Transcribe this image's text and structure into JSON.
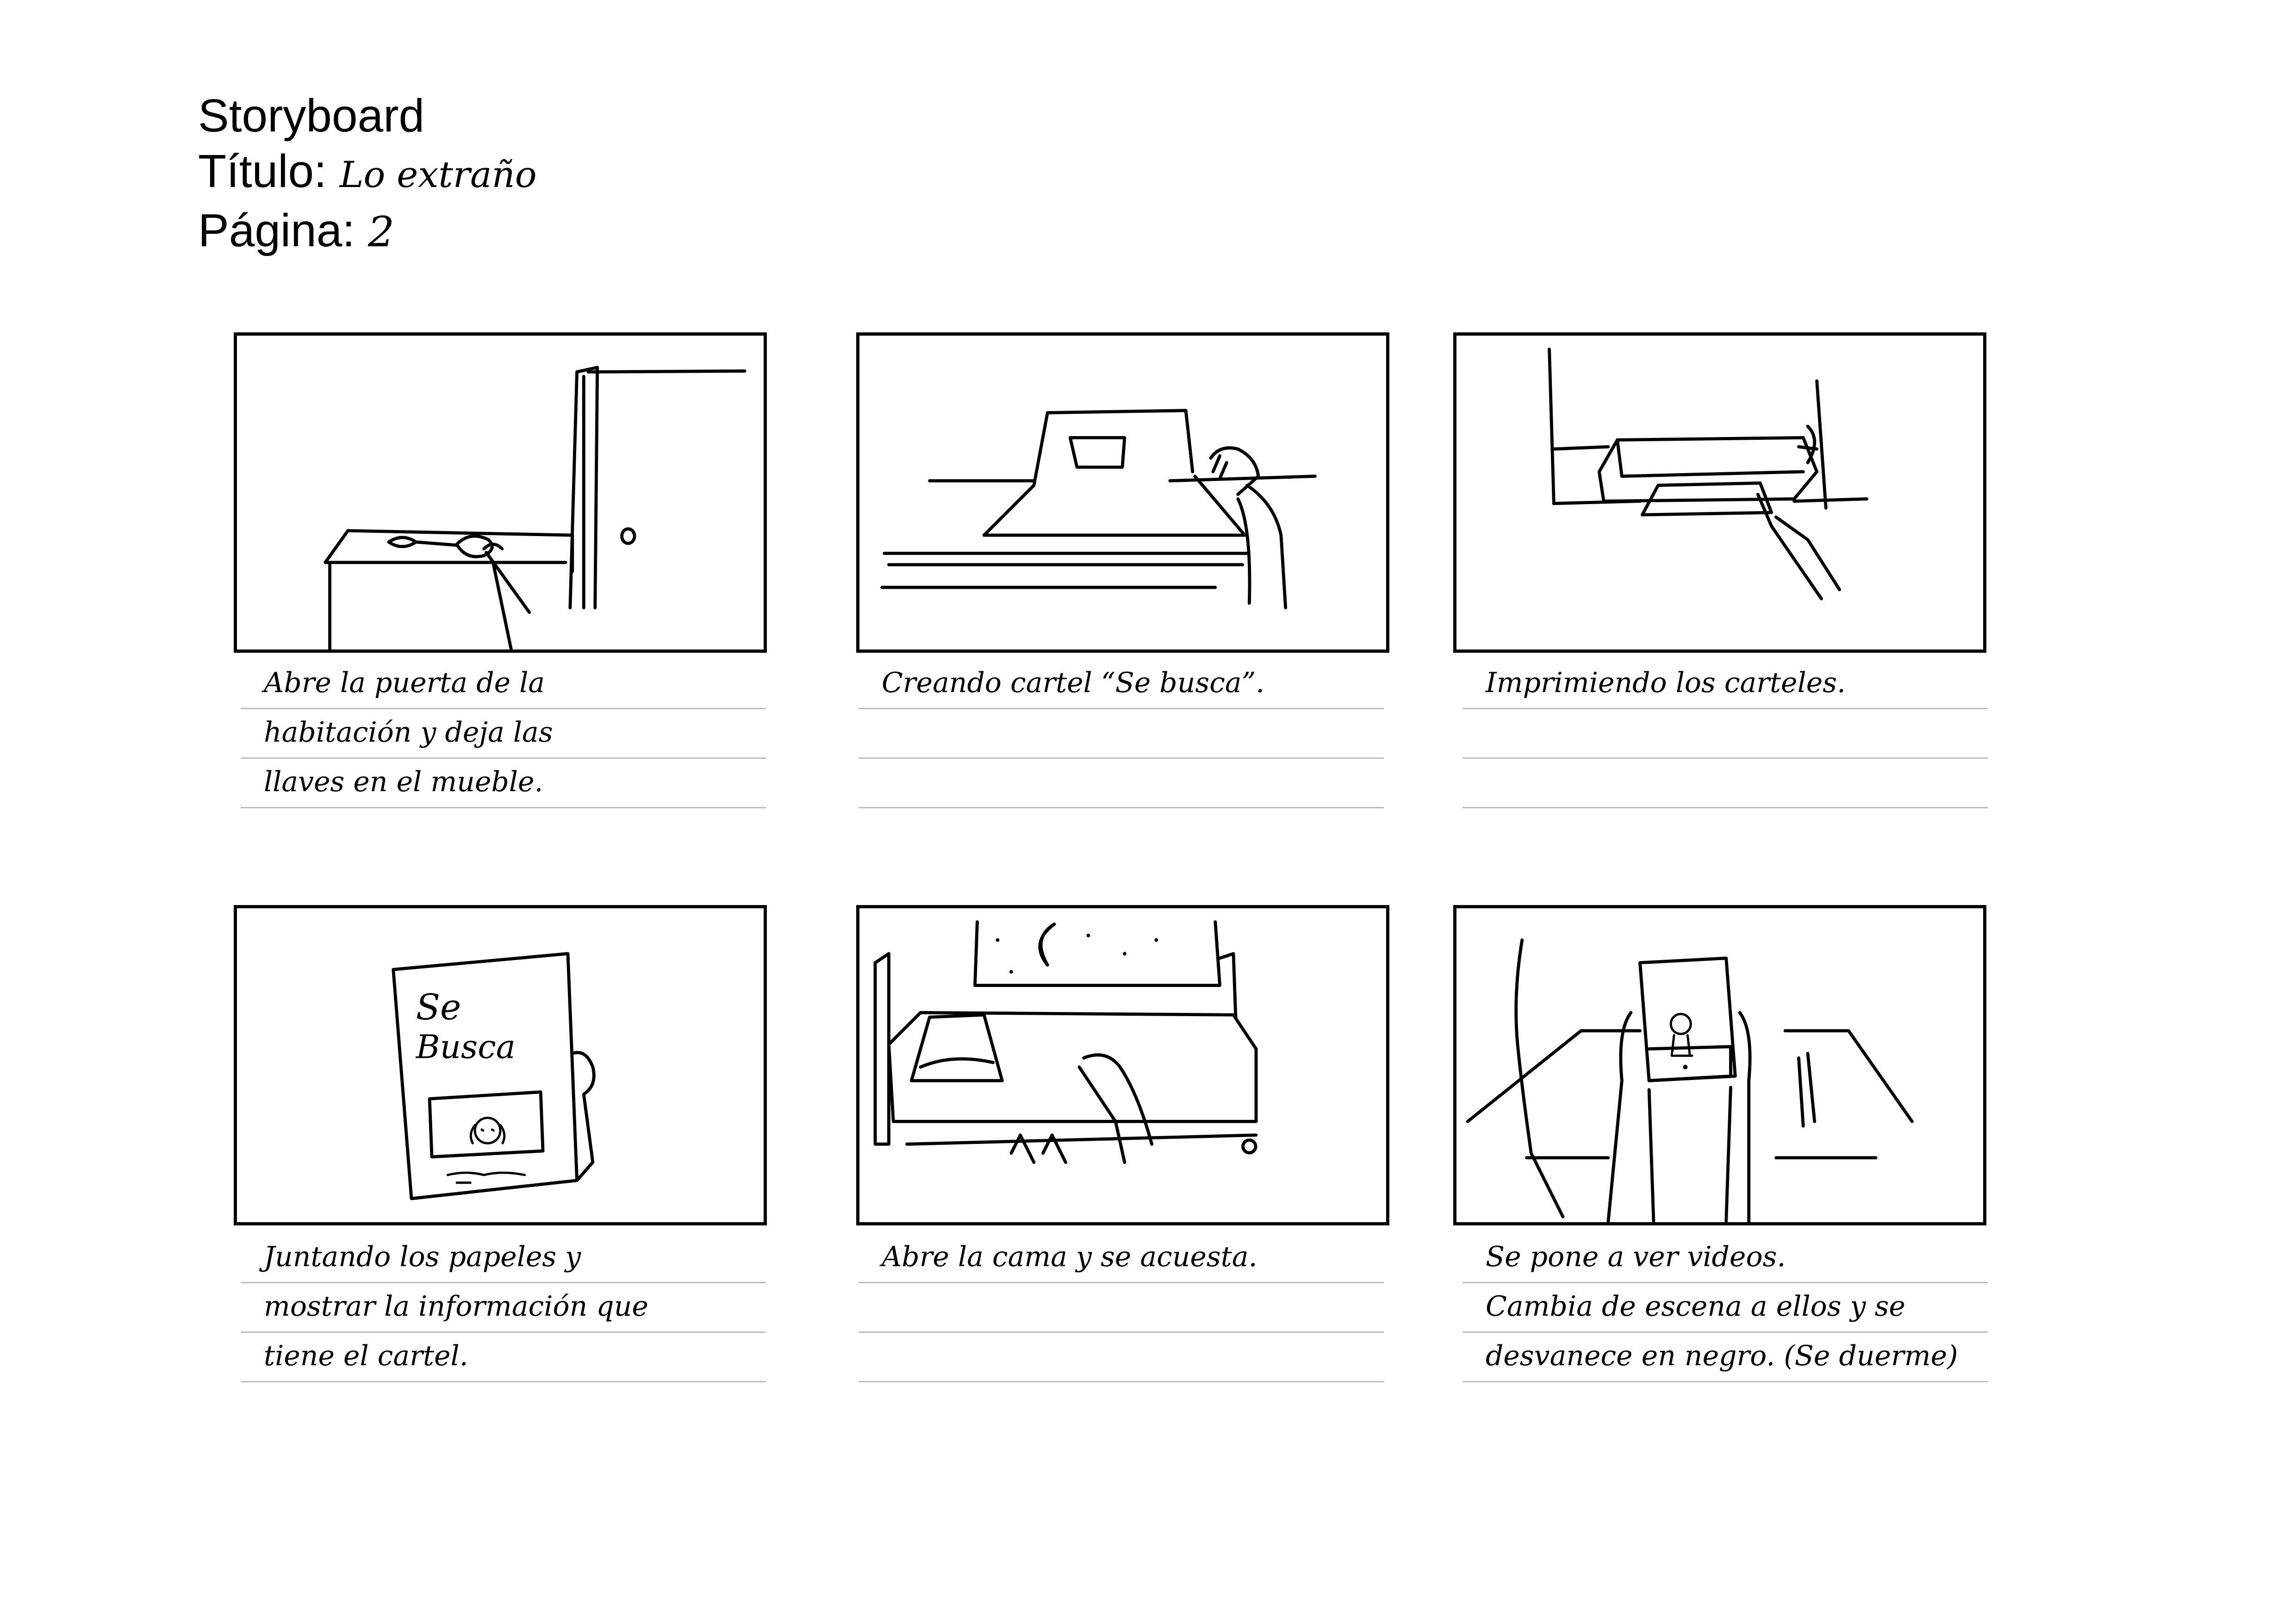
{
  "header": {
    "title": "Storyboard",
    "title_label": "Título:",
    "title_value": "Lo extraño",
    "page_label": "Página:",
    "page_value": "2"
  },
  "panels": [
    {
      "caption": [
        "Abre la puerta de la",
        "habitación y deja las",
        "llaves en el mueble."
      ]
    },
    {
      "caption": [
        "Creando cartel “Se busca”.",
        "",
        ""
      ]
    },
    {
      "caption": [
        "Imprimiendo los carteles.",
        "",
        ""
      ]
    },
    {
      "caption": [
        "Juntando los papeles y",
        "mostrar la información que",
        "tiene el cartel."
      ],
      "sketch_text": [
        "Se",
        "Busca"
      ]
    },
    {
      "caption": [
        "Abre la cama y se acuesta.",
        "",
        ""
      ]
    },
    {
      "caption": [
        "Se pone a ver videos.",
        "Cambia de escena a ellos y se",
        "desvanece en negro. (Se duerme)"
      ]
    }
  ]
}
